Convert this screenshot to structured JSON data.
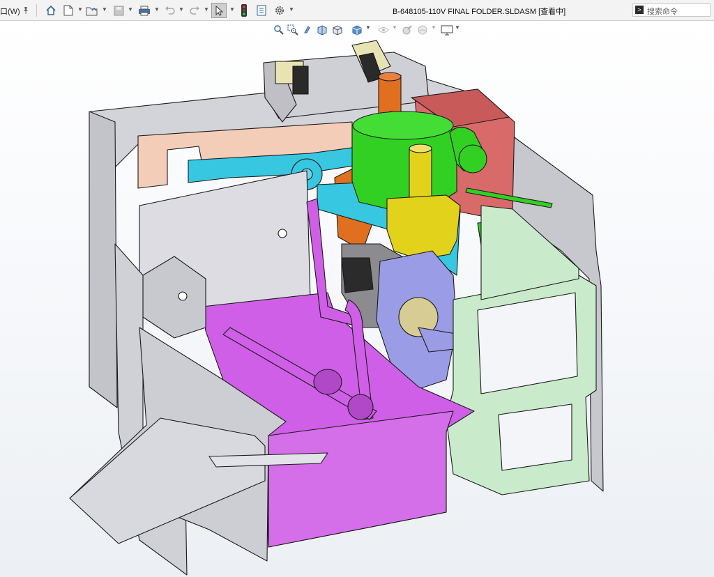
{
  "menu": {
    "window_label": "口(W)"
  },
  "document": {
    "title": "B-648105-110V FINAL FOLDER.SLDASM [查看中]"
  },
  "search": {
    "placeholder": "搜索命令"
  },
  "toolbar": {
    "icons": [
      "pin-icon",
      "home-icon",
      "new-file-icon",
      "open-folder-icon",
      "save-icon",
      "print-icon",
      "undo-icon",
      "redo-icon",
      "select-arrow-icon",
      "traffic-light-icon",
      "file-properties-icon",
      "options-gear-icon"
    ]
  },
  "heads_up_toolbar": {
    "icons": [
      "zoom-to-fit-icon",
      "zoom-area-icon",
      "previous-view-icon",
      "section-view-icon",
      "view-orientation-icon",
      "display-style-icon",
      "hide-show-icon",
      "edit-appearance-icon",
      "apply-scene-icon",
      "view-settings-icon"
    ]
  },
  "colors": {
    "housing_gray": "#d3d4da",
    "base_magenta": "#cf5fe6",
    "motor_green": "#33d024",
    "cover_red": "#d86a6a",
    "frame_light_green": "#c9ebcc",
    "bracket_cyan": "#37c7e0",
    "block_yellow": "#e2d21c",
    "drive_periwinkle": "#9a9ce6",
    "pipe_orange": "#e07020",
    "panel_peach": "#f4cdb9"
  }
}
